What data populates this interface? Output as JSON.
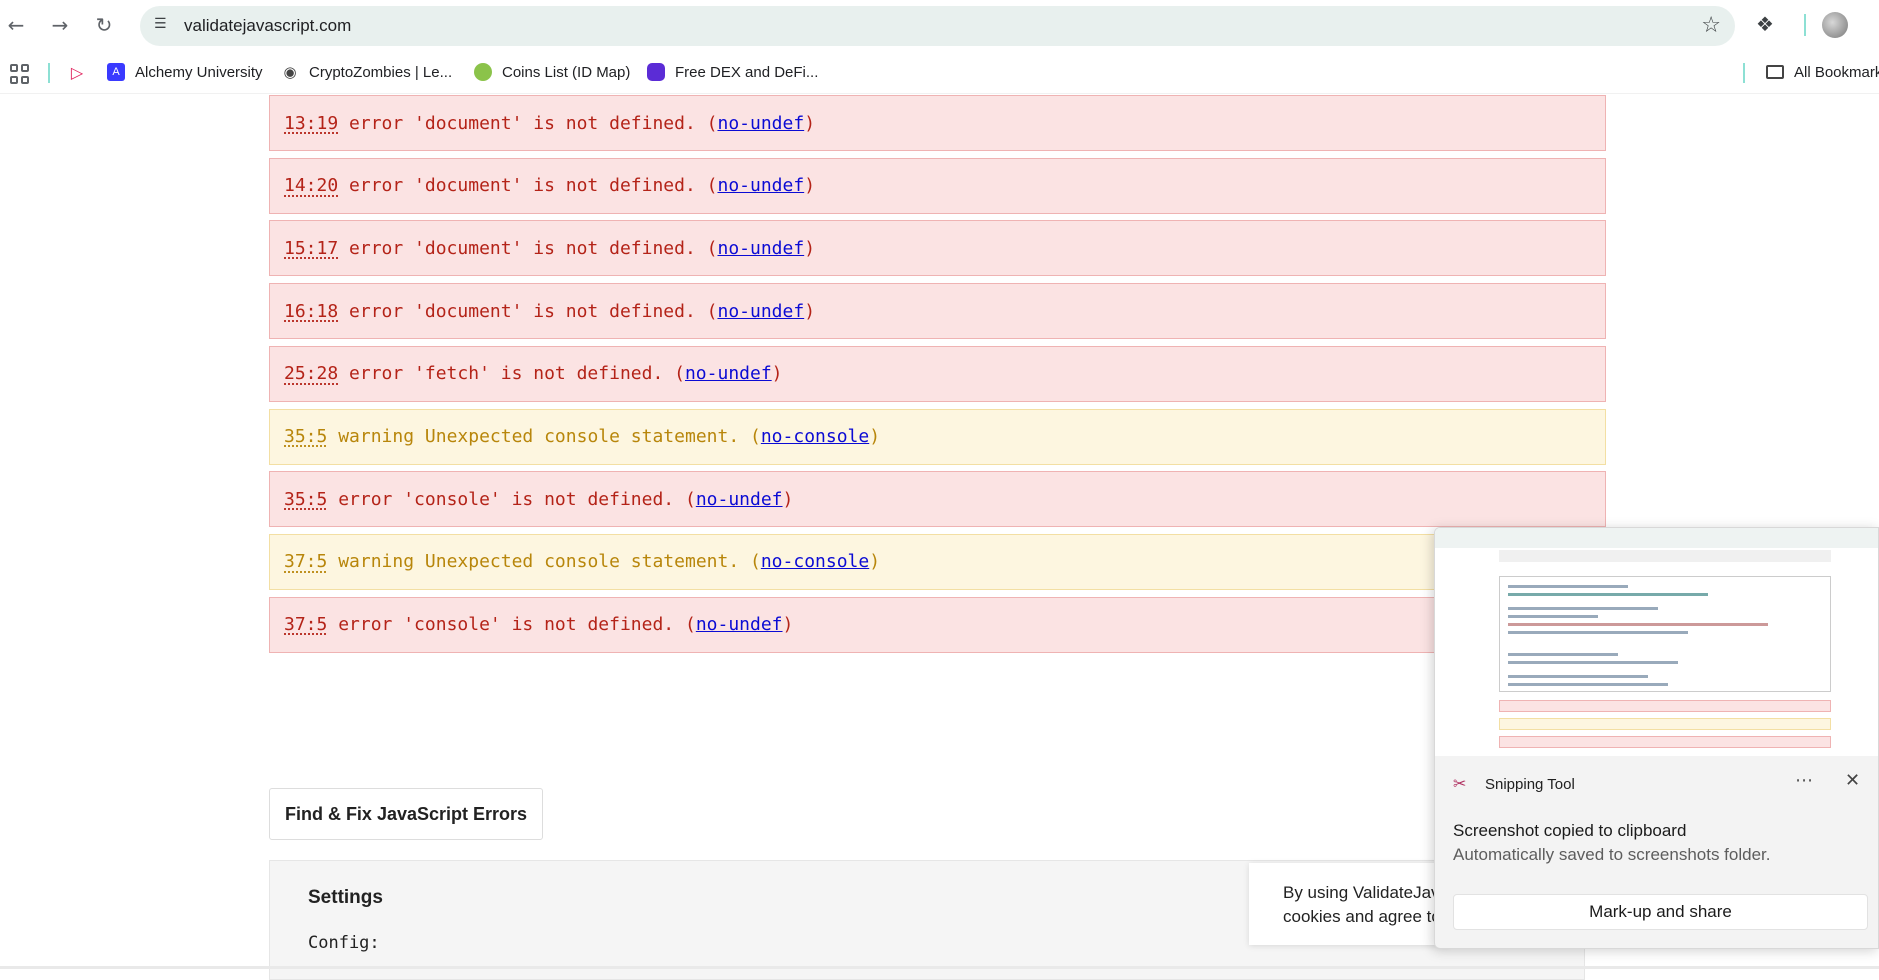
{
  "browser": {
    "url": "validatejavascript.com",
    "bookmarks": [
      {
        "label": "Alchemy University",
        "icon": "alchemy-icon"
      },
      {
        "label": "CryptoZombies | Le...",
        "icon": "globe-icon"
      },
      {
        "label": "Coins List (ID Map)",
        "icon": "coingecko-icon"
      },
      {
        "label": "Free DEX and DeFi...",
        "icon": "dex-icon"
      }
    ],
    "all_bookmarks": "All Bookmarks"
  },
  "messages": [
    {
      "type": "error",
      "loc": "13:19",
      "text": " error 'document' is not defined. (",
      "rule": "no-undef",
      "close": ")"
    },
    {
      "type": "error",
      "loc": "14:20",
      "text": " error 'document' is not defined. (",
      "rule": "no-undef",
      "close": ")"
    },
    {
      "type": "error",
      "loc": "15:17",
      "text": " error 'document' is not defined. (",
      "rule": "no-undef",
      "close": ")"
    },
    {
      "type": "error",
      "loc": "16:18",
      "text": " error 'document' is not defined. (",
      "rule": "no-undef",
      "close": ")"
    },
    {
      "type": "error",
      "loc": "25:28",
      "text": " error 'fetch' is not defined. (",
      "rule": "no-undef",
      "close": ")"
    },
    {
      "type": "warning",
      "loc": "35:5",
      "text": " warning Unexpected console statement. (",
      "rule": "no-console",
      "close": ")"
    },
    {
      "type": "error",
      "loc": "35:5",
      "text": " error 'console' is not defined. (",
      "rule": "no-undef",
      "close": ")"
    },
    {
      "type": "warning",
      "loc": "37:5",
      "text": " warning Unexpected console statement. (",
      "rule": "no-console",
      "close": ")"
    },
    {
      "type": "error",
      "loc": "37:5",
      "text": " error 'console' is not defined. (",
      "rule": "no-undef",
      "close": ")"
    }
  ],
  "fix_button": "Find & Fix JavaScript Errors",
  "settings": {
    "title": "Settings",
    "config_label": "Config:"
  },
  "cookie": {
    "line1": "By using ValidateJava",
    "line2": "cookies and agree to"
  },
  "snipping": {
    "app": "Snipping Tool",
    "more": "⋯",
    "close": "✕",
    "title": "Screenshot copied to clipboard",
    "subtitle": "Automatically saved to screenshots folder.",
    "button": "Mark-up and share"
  },
  "colors": {
    "error_bg": "#fbe3e3",
    "warning_bg": "#fdf6e0",
    "error_text": "#b42318",
    "warning_text": "#b8860b",
    "link": "#0b0bd4"
  }
}
